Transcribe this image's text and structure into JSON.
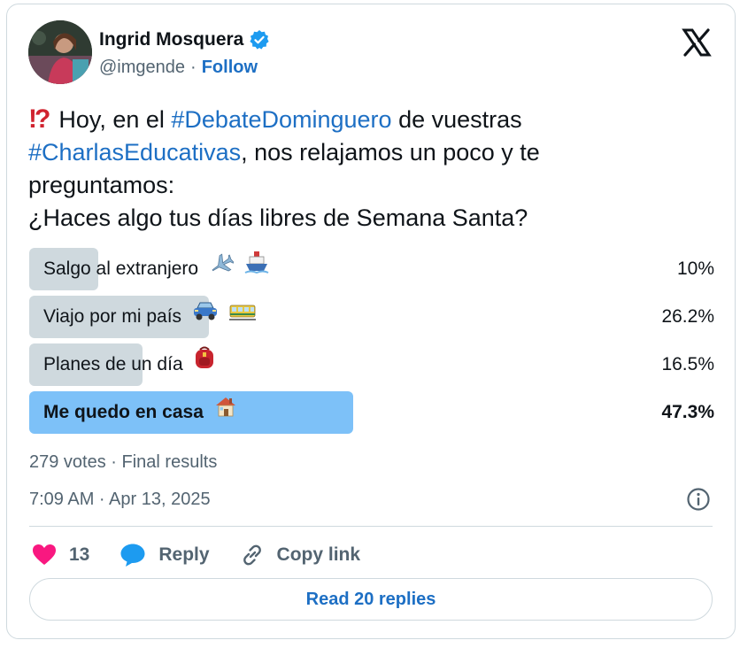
{
  "author": {
    "name": "Ingrid Mosquera",
    "handle": "@imgende",
    "separator": "·",
    "follow_label": "Follow"
  },
  "tweet": {
    "line1_prefix": "Hoy, en el ",
    "hashtag1": "#DebateDominguero",
    "line1_suffix": " de vuestras",
    "hashtag2": "#CharlasEducativas",
    "line2_suffix": ", nos relajamos un poco y te",
    "line3": "preguntamos:",
    "line4": "¿Haces algo tus días libres de Semana Santa?"
  },
  "poll": {
    "options": [
      {
        "label": "Salgo al extranjero",
        "percent_text": "10%",
        "percent": 10.0,
        "icons": [
          "airplane-icon",
          "ship-icon"
        ],
        "winner": false
      },
      {
        "label": "Viajo por mi país",
        "percent_text": "26.2%",
        "percent": 26.2,
        "icons": [
          "car-icon",
          "tram-icon"
        ],
        "winner": false
      },
      {
        "label": "Planes de un día",
        "percent_text": "16.5%",
        "percent": 16.5,
        "icons": [
          "backpack-icon"
        ],
        "winner": false
      },
      {
        "label": "Me quedo en casa",
        "percent_text": "47.3%",
        "percent": 47.3,
        "icons": [
          "house-icon"
        ],
        "winner": true
      }
    ],
    "meta": "279 votes · Final results"
  },
  "timestamp": "7:09 AM · Apr 13, 2025",
  "actions": {
    "likes_count": "13",
    "reply_label": "Reply",
    "copy_label": "Copy link"
  },
  "read_replies_label": "Read 20 replies",
  "colors": {
    "link": "#1d6fc4",
    "bar": "#cfd9de",
    "winner_bar": "#7dc1f8",
    "heart": "#f91880",
    "reply_bubble": "#1d9bf0"
  }
}
